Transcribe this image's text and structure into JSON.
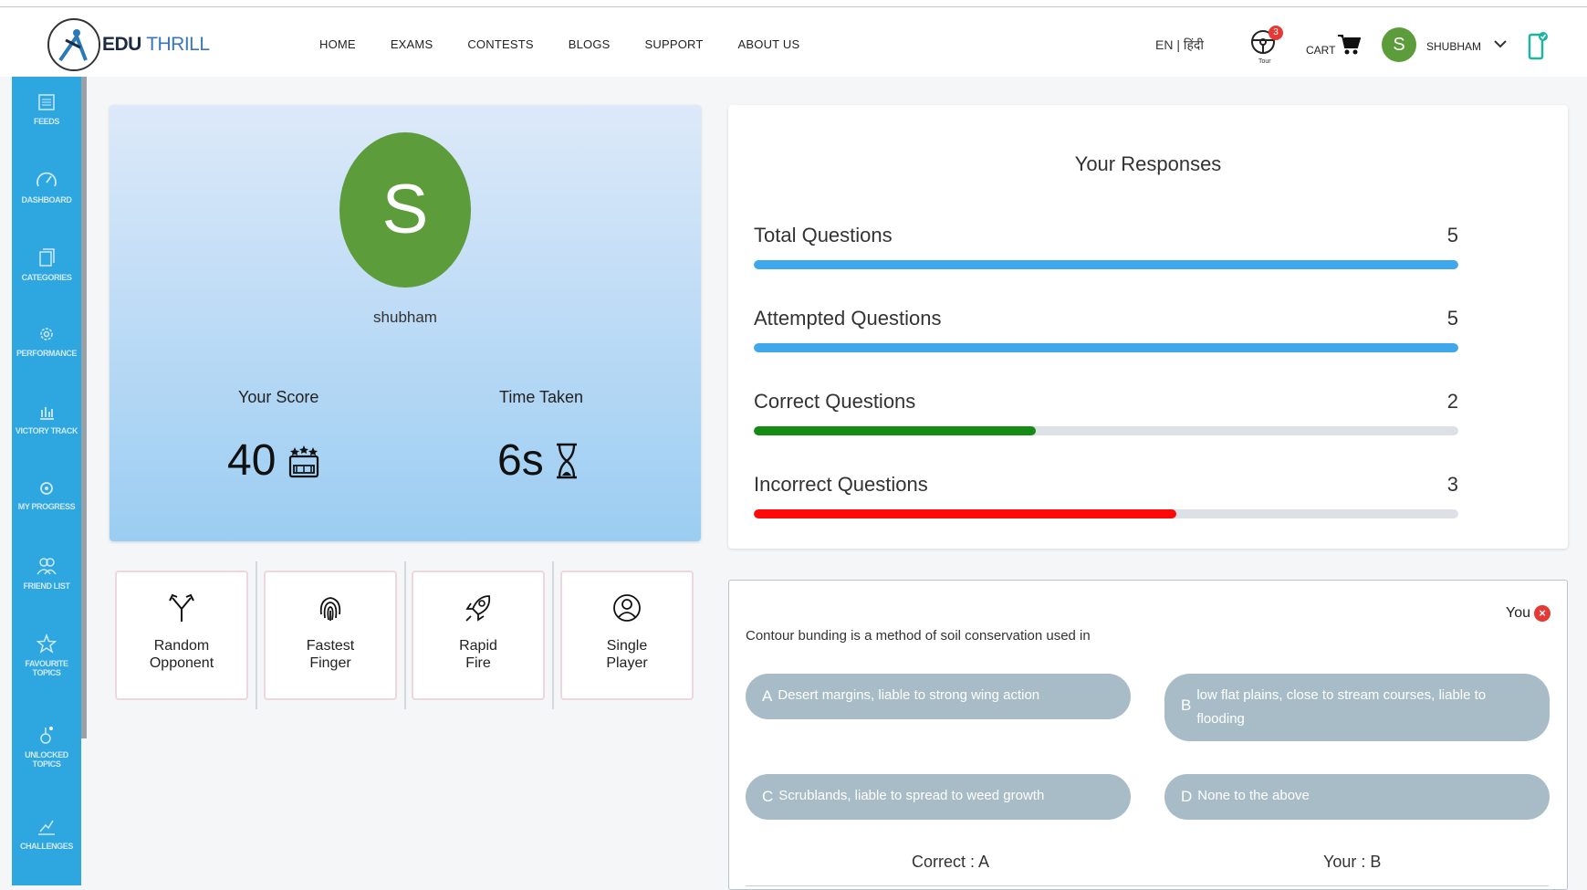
{
  "brand": {
    "part1": "EDU",
    "part2": "THRILL"
  },
  "nav": [
    "HOME",
    "EXAMS",
    "CONTESTS",
    "BLOGS",
    "SUPPORT",
    "ABOUT US"
  ],
  "header": {
    "language": "EN | हिंदी",
    "tour_badge": "3",
    "tour_label": "Tour",
    "cart_label": "CART",
    "user_initial": "S",
    "user_name": "SHUBHAM"
  },
  "sidebar": [
    {
      "label": "FEEDS",
      "icon": "feeds-icon"
    },
    {
      "label": "DASHBOARD",
      "icon": "speedometer-icon"
    },
    {
      "label": "CATEGORIES",
      "icon": "categories-icon"
    },
    {
      "label": "PERFORMANCE",
      "icon": "gear-icon"
    },
    {
      "label": "VICTORY TRACK",
      "icon": "bar-chart-icon"
    },
    {
      "label": "MY PROGRESS",
      "icon": "progress-icon"
    },
    {
      "label": "FRIEND LIST",
      "icon": "friends-icon"
    },
    {
      "label": "FAVOURITE TOPICS",
      "icon": "star-icon"
    },
    {
      "label": "UNLOCKED TOPICS",
      "icon": "unlock-icon"
    },
    {
      "label": "CHALLENGES",
      "icon": "challenge-icon"
    }
  ],
  "profile": {
    "initial": "S",
    "name": "shubham",
    "score_label": "Your Score",
    "score_value": "40",
    "time_label": "Time Taken",
    "time_value": "6s"
  },
  "modes": [
    {
      "line1": "Random",
      "line2": "Opponent",
      "icon": "split-arrows-icon"
    },
    {
      "line1": "Fastest",
      "line2": "Finger",
      "icon": "fingerprint-icon"
    },
    {
      "line1": "Rapid",
      "line2": "Fire",
      "icon": "rocket-icon"
    },
    {
      "line1": "Single",
      "line2": "Player",
      "icon": "user-circle-icon"
    }
  ],
  "responses": {
    "title": "Your Responses",
    "stats": [
      {
        "label": "Total Questions",
        "value": "5",
        "fraction": 1.0,
        "color": "#3ea8ea"
      },
      {
        "label": "Attempted Questions",
        "value": "5",
        "fraction": 1.0,
        "color": "#3ea8ea"
      },
      {
        "label": "Correct Questions",
        "value": "2",
        "fraction": 0.4,
        "color": "#158a15"
      },
      {
        "label": "Incorrect Questions",
        "value": "3",
        "fraction": 0.6,
        "color": "#ff0a0a"
      }
    ]
  },
  "question": {
    "text": "Contour bunding is a method of soil conservation used in",
    "you_label": "You",
    "options": [
      {
        "letter": "A",
        "text": "Desert margins, liable to strong wing action"
      },
      {
        "letter": "B",
        "text": "low flat plains, close to stream courses, liable to flooding"
      },
      {
        "letter": "C",
        "text": "Scrublands, liable to spread to weed growth"
      },
      {
        "letter": "D",
        "text": "None to the above"
      }
    ],
    "correct": "Correct : A",
    "yours": "Your : B"
  }
}
